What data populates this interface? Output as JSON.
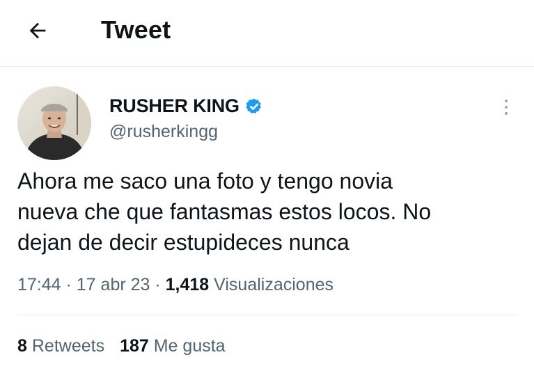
{
  "header": {
    "back_icon": "arrow-left-icon",
    "title": "Tweet"
  },
  "author": {
    "display_name": "RUSHER KING",
    "verified_icon": "verified-badge-icon",
    "verified_color": "#1d9bf0",
    "handle": "@rusherkingg",
    "more_icon": "more-vertical-icon"
  },
  "tweet": {
    "lines": [
      "Ahora me saco una foto y tengo novia",
      "nueva che que fantasmas estos locos. No",
      "dejan de decir estupideces nunca"
    ]
  },
  "meta": {
    "time": "17:44",
    "separator": " · ",
    "date": "17 abr 23",
    "views_count": "1,418",
    "views_label": "Visualizaciones"
  },
  "stats": {
    "retweets_count": "8",
    "retweets_label": "Retweets",
    "likes_count": "187",
    "likes_label": "Me gusta"
  }
}
